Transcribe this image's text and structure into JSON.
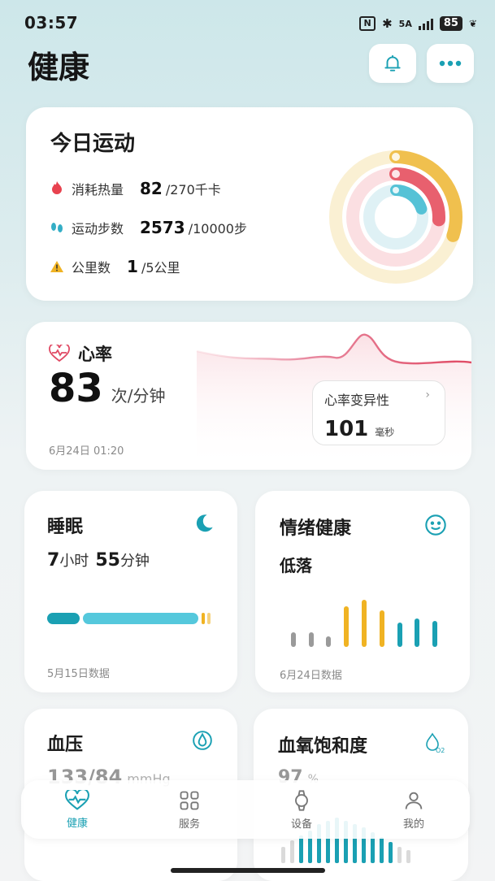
{
  "status_bar": {
    "time": "03:57",
    "nfc": "N",
    "network": "5A",
    "battery": "85"
  },
  "page": {
    "title": "健康"
  },
  "exercise": {
    "title": "今日运动",
    "rows": [
      {
        "label": "消耗热量",
        "value": "82",
        "goal": "/270千卡",
        "icon": "flame-icon",
        "color": "#e8424f"
      },
      {
        "label": "运动步数",
        "value": "2573",
        "goal": "/10000步",
        "icon": "footprints-icon",
        "color": "#34aec6"
      },
      {
        "label": "公里数",
        "value": "1",
        "goal": "/5公里",
        "icon": "warning-icon",
        "color": "#f0b323"
      }
    ],
    "rings": [
      {
        "name": "calories",
        "progress": 0.3,
        "color": "#f0c04e",
        "track": "#faf0d3"
      },
      {
        "name": "steps",
        "progress": 0.26,
        "color": "#e8606e",
        "track": "#fbdfe2"
      },
      {
        "name": "distance",
        "progress": 0.2,
        "color": "#55c2d6",
        "track": "#dff1f5"
      }
    ]
  },
  "heart_rate": {
    "label": "心率",
    "value": "83",
    "unit": "次/分钟",
    "date": "6月24日 01:20",
    "hrv": {
      "label": "心率变异性",
      "value": "101",
      "unit": "毫秒"
    }
  },
  "sleep": {
    "title": "睡眠",
    "hours": "7",
    "hours_unit": "小时",
    "minutes": "55",
    "minutes_unit": "分钟",
    "date": "5月15日数据"
  },
  "mood": {
    "title": "情绪健康",
    "status": "低落",
    "date": "6月24日数据",
    "bars": [
      {
        "level": 0.25,
        "color": "#9a9a9a"
      },
      {
        "level": 0.25,
        "color": "#9a9a9a"
      },
      {
        "level": 0.18,
        "color": "#9a9a9a"
      },
      {
        "level": 0.7,
        "color": "#f0b323"
      },
      {
        "level": 0.8,
        "color": "#f0b323"
      },
      {
        "level": 0.62,
        "color": "#f0b323"
      },
      {
        "level": 0.42,
        "color": "#1aa0b3"
      },
      {
        "level": 0.48,
        "color": "#1aa0b3"
      },
      {
        "level": 0.45,
        "color": "#1aa0b3"
      }
    ]
  },
  "blood_pressure": {
    "title": "血压",
    "value": "133/84",
    "unit": "mmHg"
  },
  "spo2": {
    "title": "血氧饱和度",
    "value": "97",
    "unit": "%"
  },
  "nav": {
    "items": [
      {
        "label": "健康",
        "active": true
      },
      {
        "label": "服务",
        "active": false
      },
      {
        "label": "设备",
        "active": false
      },
      {
        "label": "我的",
        "active": false
      }
    ]
  },
  "colors": {
    "accent": "#1aa0b3",
    "heart": "#e04a64"
  }
}
